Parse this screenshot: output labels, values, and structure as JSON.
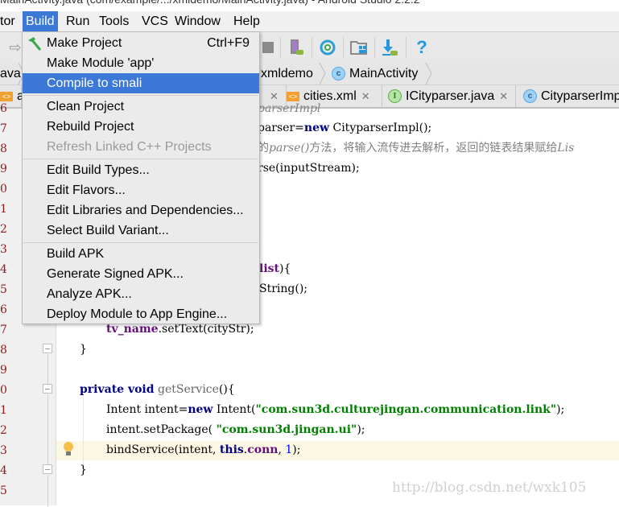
{
  "window": {
    "title": "MainActivity.java (com/example/.../xmldemo/MainActivity.java) - Android Studio 2.2.2"
  },
  "menubar": {
    "items": [
      {
        "label": "tor",
        "mnemonic": ""
      },
      {
        "label": "Build",
        "active": true
      },
      {
        "label": "Run"
      },
      {
        "label": "Tools"
      },
      {
        "label": "VCS"
      },
      {
        "label": "Window"
      },
      {
        "label": "Help"
      }
    ]
  },
  "toolbar": {
    "icons": [
      "forward-arrow-icon",
      "stop-icon",
      "avd-manager-icon",
      "sync-gradle-icon",
      "project-structure-icon",
      "sdk-manager-icon",
      "help-icon"
    ]
  },
  "navbar": {
    "crumbs": [
      "ava",
      "xmldemo",
      "MainActivity"
    ]
  },
  "tabs": [
    {
      "label": "ac",
      "icon": "xml-file-icon"
    },
    {
      "label": "",
      "icon": ""
    },
    {
      "label": "cities.xml",
      "icon": "xml-file-icon"
    },
    {
      "label": "ICityparser.java",
      "icon": "interface-icon"
    },
    {
      "label": "CityparserImp",
      "icon": "class-icon"
    }
  ],
  "build_menu": {
    "items": [
      {
        "label": "Make Project",
        "shortcut": "Ctrl+F9",
        "icon": "hammer-icon"
      },
      {
        "label": "Make Module 'app'"
      },
      {
        "label": "Compile to smali",
        "selected": true
      },
      {
        "label": "Clean Project"
      },
      {
        "label": "Rebuild Project"
      },
      {
        "label": "Refresh Linked C++ Projects",
        "disabled": true
      },
      {
        "label": "Edit Build Types..."
      },
      {
        "label": "Edit Flavors..."
      },
      {
        "label": "Edit Libraries and Dependencies..."
      },
      {
        "label": "Select Build Variant..."
      },
      {
        "label": "Build APK"
      },
      {
        "label": "Generate Signed APK..."
      },
      {
        "label": "Analyze APK..."
      },
      {
        "label": "Deploy Module to App Engine..."
      }
    ]
  },
  "gutter": {
    "line_numbers": [
      "6",
      "7",
      "8",
      "9",
      "0",
      "1",
      "2",
      "3",
      "4",
      "5",
      "6",
      "7",
      "8",
      "9",
      "0",
      "1",
      "2",
      "3",
      "4",
      "5"
    ]
  },
  "code": {
    "line_6": "parserImpl",
    "line_7_a": "parser=",
    "line_7_kw": "new",
    "line_7_b": " CityparserImpl();",
    "line_8_a": "的",
    "line_8_b": "parse()",
    "line_8_c": "方法，将输入流传进去解析，返回的链表结果赋给",
    "line_8_d": "Lis",
    "line_9": "rse(inputStream);",
    "line_14_a": "list",
    "line_14_b": "){",
    "line_15": "String();",
    "line_17_fld": "tv_name",
    "line_17_b": ".setText(cityStr);",
    "line_18": "}",
    "line_20_kw": "private void",
    "line_20_b": " getService",
    "line_20_c": "(){",
    "line_21_a": "Intent intent=",
    "line_21_kw": "new",
    "line_21_b": " Intent(",
    "line_21_str": "\"com.sun3d.culturejingan.communication.link\"",
    "line_21_c": ");",
    "line_22_a": "intent.setPackage( ",
    "line_22_str": "\"com.sun3d.jingan.ui\"",
    "line_22_c": ");",
    "line_23_a": "bindService(intent, ",
    "line_23_kw": "this",
    "line_23_dot": ".",
    "line_23_fld": "conn",
    "line_23_b": ", ",
    "line_23_num": "1",
    "line_23_c": ");",
    "line_24": "}"
  },
  "watermark": "http://blog.csdn.net/wxk105"
}
